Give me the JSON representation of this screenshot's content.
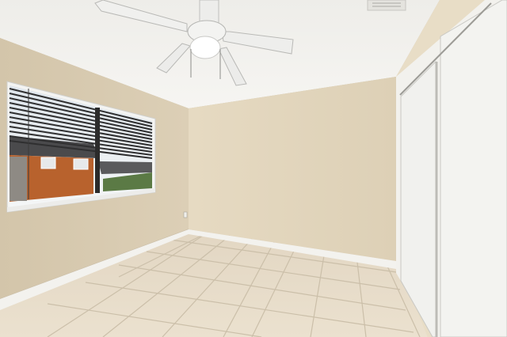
{
  "scene": {
    "description_name": "empty-bedroom-photo",
    "colors": {
      "ceiling": "#f3f2ee",
      "wall_left": "#d9ccb3",
      "wall_back": "#e4d8c0",
      "wall_right": "#e9dfc9",
      "baseboard": "#f4f3ef",
      "tile": "#e6dbc9",
      "grout": "#c9bca7",
      "closet_door": "#f1f1ee",
      "closet_shadow": "#d6d5d0",
      "fan": "#f2f2f1",
      "window_frame": "#f5f5f3",
      "blind_dark": "#2b2b2b",
      "house_brick": "#b35a2a"
    },
    "objects": {
      "ceiling_fan": "ceiling-fan",
      "window": "window-with-blinds",
      "closet": "sliding-closet-doors",
      "vent": "ceiling-vent",
      "floor": "tile-floor"
    }
  }
}
